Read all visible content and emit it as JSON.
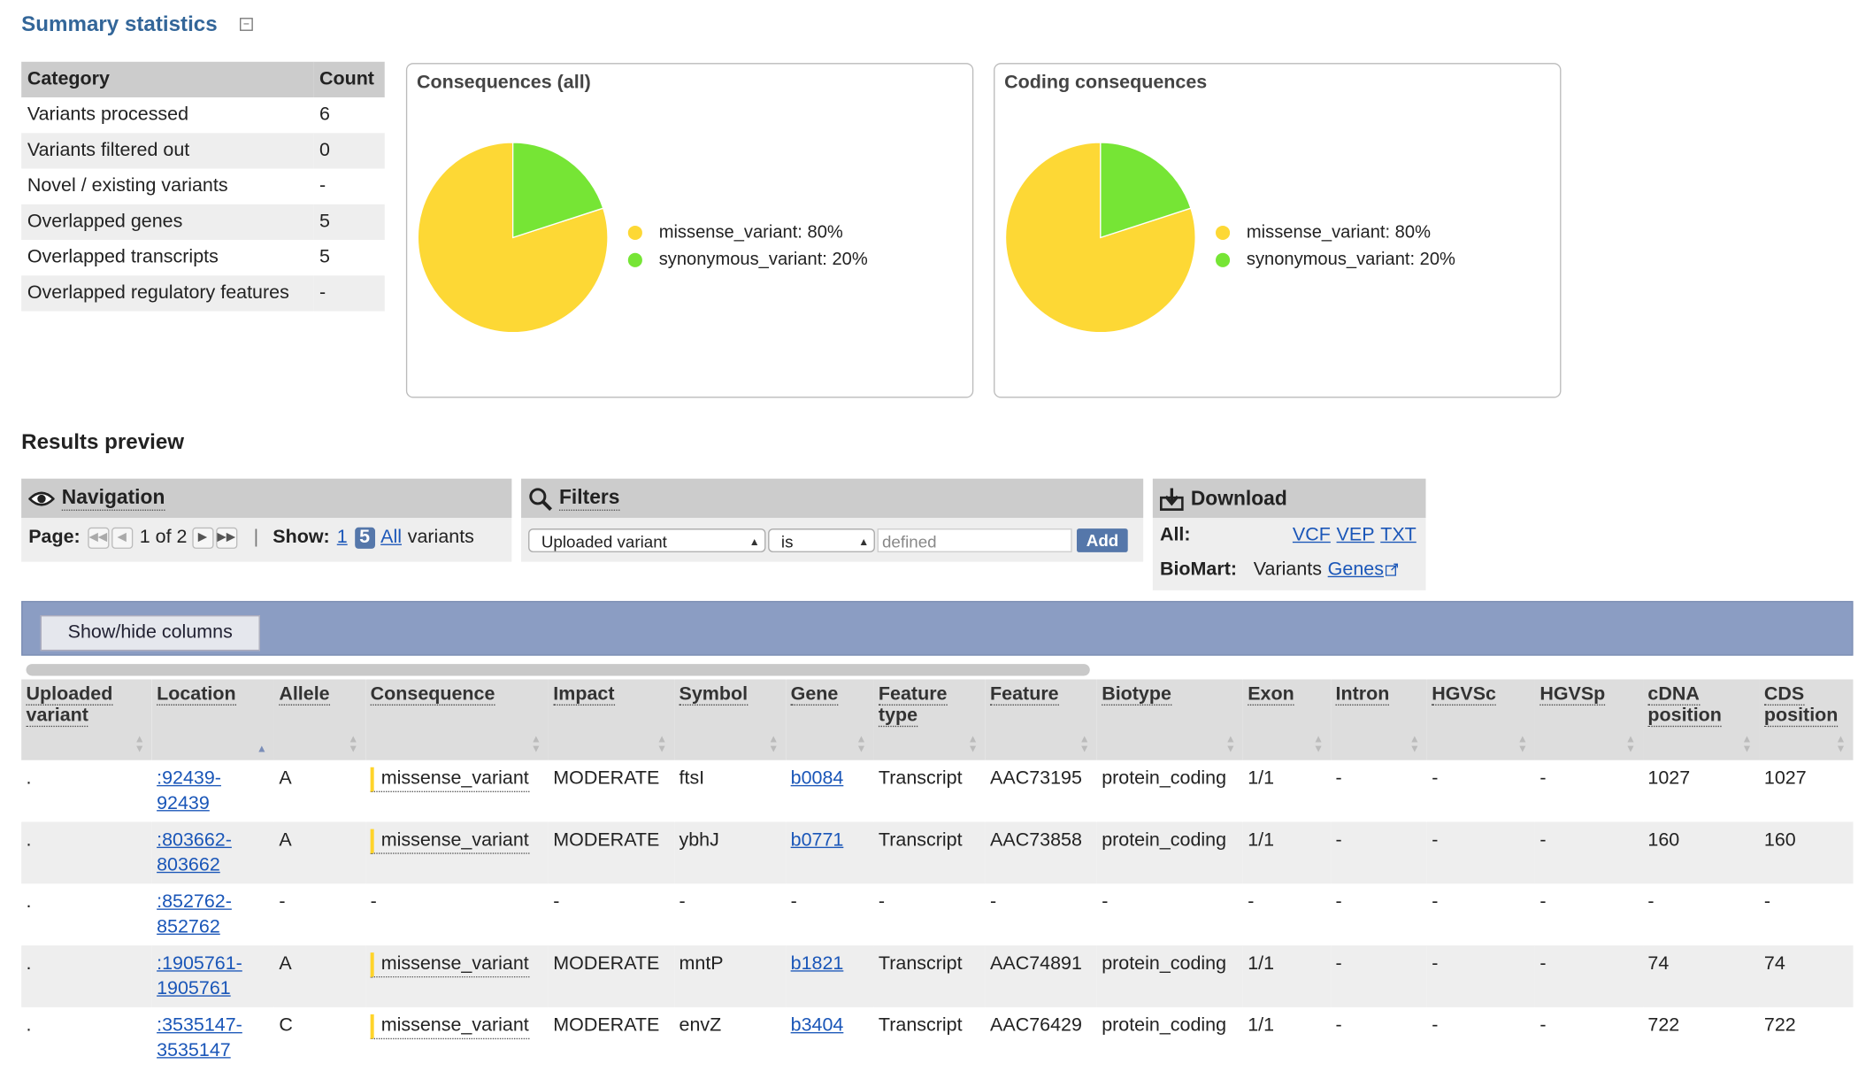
{
  "summary": {
    "title": "Summary statistics",
    "collapse_glyph": "−",
    "headers": [
      "Category",
      "Count"
    ],
    "rows": [
      {
        "category": "Variants processed",
        "count": "6"
      },
      {
        "category": "Variants filtered out",
        "count": "0"
      },
      {
        "category": "Novel / existing variants",
        "count": "-"
      },
      {
        "category": "Overlapped genes",
        "count": "5"
      },
      {
        "category": "Overlapped transcripts",
        "count": "5"
      },
      {
        "category": "Overlapped regulatory features",
        "count": "-"
      }
    ]
  },
  "chart_data": [
    {
      "type": "pie",
      "title": "Consequences (all)",
      "labels": [
        "missense_variant: 80%",
        "synonymous_variant: 20%"
      ],
      "values": [
        80,
        20
      ],
      "colors": [
        "#fdd835",
        "#76e535"
      ],
      "legend": "right"
    },
    {
      "type": "pie",
      "title": "Coding consequences",
      "labels": [
        "missense_variant: 80%",
        "synonymous_variant: 20%"
      ],
      "values": [
        80,
        20
      ],
      "colors": [
        "#fdd835",
        "#76e535"
      ],
      "legend": "right"
    }
  ],
  "results": {
    "title": "Results preview",
    "navigation": {
      "title": "Navigation",
      "icon": "eye-icon",
      "page_label": "Page:",
      "page_text": "1 of 2",
      "separator": "|",
      "show_label": "Show:",
      "show_1": "1",
      "show_5": "5",
      "show_all": "All",
      "variants_label": "variants"
    },
    "filters": {
      "title": "Filters",
      "icon": "magnifier-icon",
      "field_value": "Uploaded variant",
      "operator_value": "is",
      "value_placeholder": "defined",
      "add_label": "Add"
    },
    "download": {
      "title": "Download",
      "icon": "download-icon",
      "all_label": "All:",
      "vcf": "VCF",
      "vep": "VEP",
      "txt": "TXT",
      "biomart_label": "BioMart:",
      "variants_text": "Variants",
      "genes_link": "Genes"
    },
    "show_hide_label": "Show/hide columns",
    "columns": [
      [
        "Uploaded",
        "variant"
      ],
      [
        "Location",
        ""
      ],
      [
        "Allele",
        ""
      ],
      [
        "Consequence",
        ""
      ],
      [
        "Impact",
        ""
      ],
      [
        "Symbol",
        ""
      ],
      [
        "Gene",
        ""
      ],
      [
        "Feature",
        "type"
      ],
      [
        "Feature",
        ""
      ],
      [
        "Biotype",
        ""
      ],
      [
        "Exon",
        ""
      ],
      [
        "Intron",
        ""
      ],
      [
        "HGVSc",
        ""
      ],
      [
        "HGVSp",
        ""
      ],
      [
        "cDNA",
        "position"
      ],
      [
        "CDS",
        "position"
      ]
    ],
    "rows": [
      {
        "uploaded": ".",
        "loc1": ":92439-",
        "loc2": "92439",
        "allele": "A",
        "consequence": "missense_variant",
        "impact": "MODERATE",
        "symbol": "ftsI",
        "gene": "b0084",
        "ftype": "Transcript",
        "feature": "AAC73195",
        "biotype": "protein_coding",
        "exon": "1/1",
        "intron": "-",
        "hgvsc": "-",
        "hgvsp": "-",
        "cdna": "1027",
        "cds": "1027"
      },
      {
        "uploaded": ".",
        "loc1": ":803662-",
        "loc2": "803662",
        "allele": "A",
        "consequence": "missense_variant",
        "impact": "MODERATE",
        "symbol": "ybhJ",
        "gene": "b0771",
        "ftype": "Transcript",
        "feature": "AAC73858",
        "biotype": "protein_coding",
        "exon": "1/1",
        "intron": "-",
        "hgvsc": "-",
        "hgvsp": "-",
        "cdna": "160",
        "cds": "160"
      },
      {
        "uploaded": ".",
        "loc1": ":852762-",
        "loc2": "852762",
        "allele": "-",
        "consequence": "-",
        "impact": "-",
        "symbol": "-",
        "gene": "-",
        "ftype": "-",
        "feature": "-",
        "biotype": "-",
        "exon": "-",
        "intron": "-",
        "hgvsc": "-",
        "hgvsp": "-",
        "cdna": "-",
        "cds": "-"
      },
      {
        "uploaded": ".",
        "loc1": ":1905761-",
        "loc2": "1905761",
        "allele": "A",
        "consequence": "missense_variant",
        "impact": "MODERATE",
        "symbol": "mntP",
        "gene": "b1821",
        "ftype": "Transcript",
        "feature": "AAC74891",
        "biotype": "protein_coding",
        "exon": "1/1",
        "intron": "-",
        "hgvsc": "-",
        "hgvsp": "-",
        "cdna": "74",
        "cds": "74"
      },
      {
        "uploaded": ".",
        "loc1": ":3535147-",
        "loc2": "3535147",
        "allele": "C",
        "consequence": "missense_variant",
        "impact": "MODERATE",
        "symbol": "envZ",
        "gene": "b3404",
        "ftype": "Transcript",
        "feature": "AAC76429",
        "biotype": "protein_coding",
        "exon": "1/1",
        "intron": "-",
        "hgvsc": "-",
        "hgvsp": "-",
        "cdna": "722",
        "cds": "722"
      }
    ]
  }
}
